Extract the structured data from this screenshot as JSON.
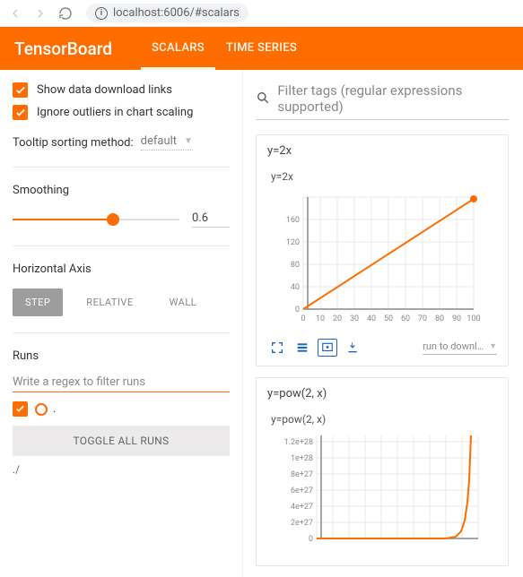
{
  "browser": {
    "url": "localhost:6006/#scalars"
  },
  "header": {
    "logo": "TensorBoard",
    "tabs": [
      {
        "key": "scalars",
        "label": "SCALARS",
        "active": true
      },
      {
        "key": "timeseries",
        "label": "TIME SERIES",
        "active": false
      }
    ]
  },
  "sidebar": {
    "show_download": "Show data download links",
    "ignore_outliers": "Ignore outliers in chart scaling",
    "tooltip_label": "Tooltip sorting method:",
    "tooltip_value": "default",
    "smoothing_label": "Smoothing",
    "smoothing_value": "0.6",
    "horizontal_axis_label": "Horizontal Axis",
    "axis_options": {
      "step": "STEP",
      "relative": "RELATIVE",
      "wall": "WALL"
    },
    "runs_label": "Runs",
    "runs_filter_placeholder": "Write a regex to filter runs",
    "run_name": ".",
    "toggle_all": "TOGGLE ALL RUNS",
    "root_path": "./"
  },
  "content": {
    "filter_placeholder": "Filter tags (regular expressions supported)",
    "run_download_label": "run to downl…"
  },
  "chart_data": [
    {
      "type": "line",
      "tag": "y=2x",
      "title": "y=2x",
      "x": [
        0,
        10,
        20,
        30,
        40,
        50,
        60,
        70,
        80,
        90,
        100
      ],
      "y": [
        0,
        20,
        40,
        60,
        80,
        100,
        120,
        140,
        160,
        180,
        198
      ],
      "xlim": [
        0,
        100
      ],
      "ylim": [
        0,
        200
      ],
      "yticks": [
        0,
        40,
        80,
        120,
        160
      ],
      "xticks": [
        0,
        10,
        20,
        30,
        40,
        50,
        60,
        70,
        80,
        90,
        100
      ],
      "color": "#ff6d00"
    },
    {
      "type": "line",
      "tag": "y=pow(2, x)",
      "title": "y=pow(2, x)",
      "x": [
        0,
        10,
        20,
        30,
        40,
        50,
        60,
        70,
        80,
        86,
        88,
        90,
        91,
        92,
        93,
        94
      ],
      "y": [
        0,
        0,
        0,
        0,
        0,
        0,
        0,
        0,
        0,
        2e+26,
        1e+27,
        3e+27,
        6e+27,
        1e+28,
        1.15e+28,
        1.3e+28
      ],
      "xlim": [
        0,
        100
      ],
      "ylim": [
        0,
        1.3e+28
      ],
      "yticks_labels": [
        "0",
        "2e+27",
        "4e+27",
        "6e+27",
        "8e+27",
        "1e+28",
        "1.2e+28"
      ],
      "yticks": [
        0,
        2e+27,
        4e+27,
        6e+27,
        8e+27,
        1e+28,
        1.2e+28
      ],
      "color": "#ff6d00"
    }
  ]
}
